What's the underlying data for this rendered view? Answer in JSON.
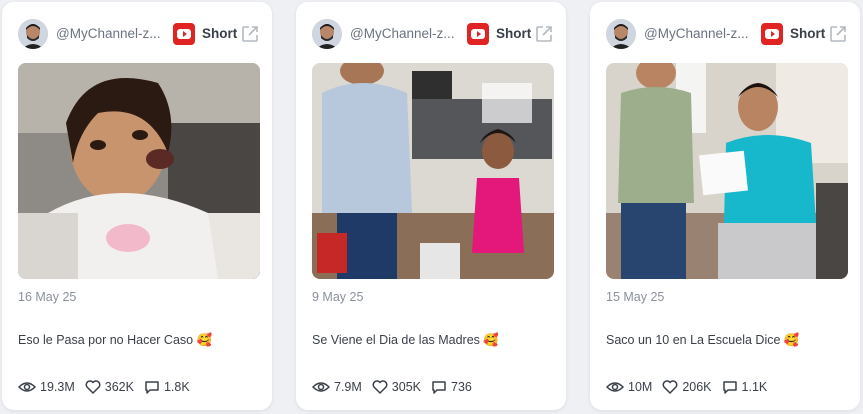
{
  "colors": {
    "youtube_red": "#e02424",
    "muted_text": "#8a919c",
    "body_text": "#3a404a"
  },
  "cards": [
    {
      "channel": "@MyChannel-z...",
      "platform_icon": "youtube-icon",
      "type": "Short",
      "date": "16 May 25",
      "title": "Eso le Pasa por no Hacer Caso 🥰",
      "views": "19.3M",
      "likes": "362K",
      "comments": "1.8K"
    },
    {
      "channel": "@MyChannel-z...",
      "platform_icon": "youtube-icon",
      "type": "Short",
      "date": "9 May 25",
      "title": "Se Viene el Dia de las Madres 🥰",
      "views": "7.9M",
      "likes": "305K",
      "comments": "736"
    },
    {
      "channel": "@MyChannel-z...",
      "platform_icon": "youtube-icon",
      "type": "Short",
      "date": "15 May 25",
      "title": "Saco un 10 en La Escuela Dice 🥰",
      "views": "10M",
      "likes": "206K",
      "comments": "1.1K"
    }
  ]
}
